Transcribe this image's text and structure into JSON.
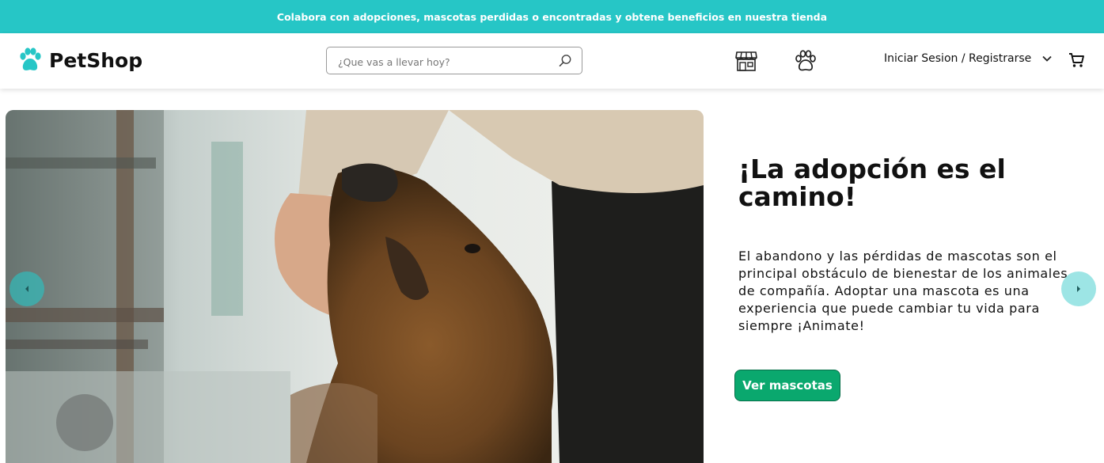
{
  "announcement": "Colabora con adopciones, mascotas perdidas o encontradas y obtene beneficios en nuestra tienda",
  "header": {
    "logo_text": "PetShop",
    "search_placeholder": "¿Que vas a llevar hoy?",
    "login_label": "Iniciar Sesion / Registrarse",
    "icons": [
      "paw-logo-icon",
      "search-icon",
      "store-icon",
      "paw-icon",
      "chevron-down-icon",
      "cart-icon"
    ]
  },
  "hero": {
    "title": "¡La adopción es el camino!",
    "description": "El abandono y las pérdidas de mascotas son el principal obstáculo de bienestar de los animales de compañía. Adoptar una mascota es una experiencia que puede cambiar tu vida para siempre ¡Animate!",
    "cta_label": "Ver mascotas"
  },
  "colors": {
    "accent": "#26c6c6",
    "cta": "#0aa86e"
  }
}
